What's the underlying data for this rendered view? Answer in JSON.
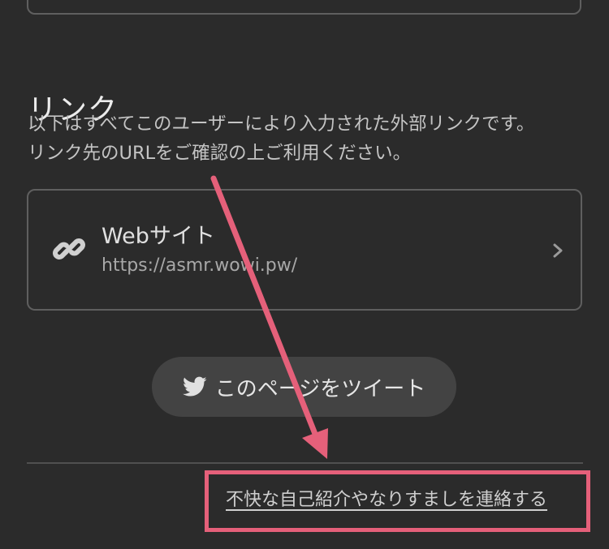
{
  "section": {
    "title": "リンク",
    "description_line1": "以下はすべてこのユーザーにより入力された外部リンクです。",
    "description_line2": "リンク先のURLをご確認の上ご利用ください。"
  },
  "link_card": {
    "title": "Webサイト",
    "url": "https://asmr.wowi.pw/",
    "icon": "link-icon",
    "chevron": "chevron-right-icon"
  },
  "tweet_button": {
    "label": "このページをツイート",
    "icon": "twitter-bird-icon"
  },
  "report_link": {
    "label": "不快な自己紹介やなりすましを連絡する"
  },
  "annotation": {
    "color": "#e5607a"
  },
  "colors": {
    "background": "#2b2b2b",
    "border": "#5f5f5f",
    "button": "#434343"
  }
}
